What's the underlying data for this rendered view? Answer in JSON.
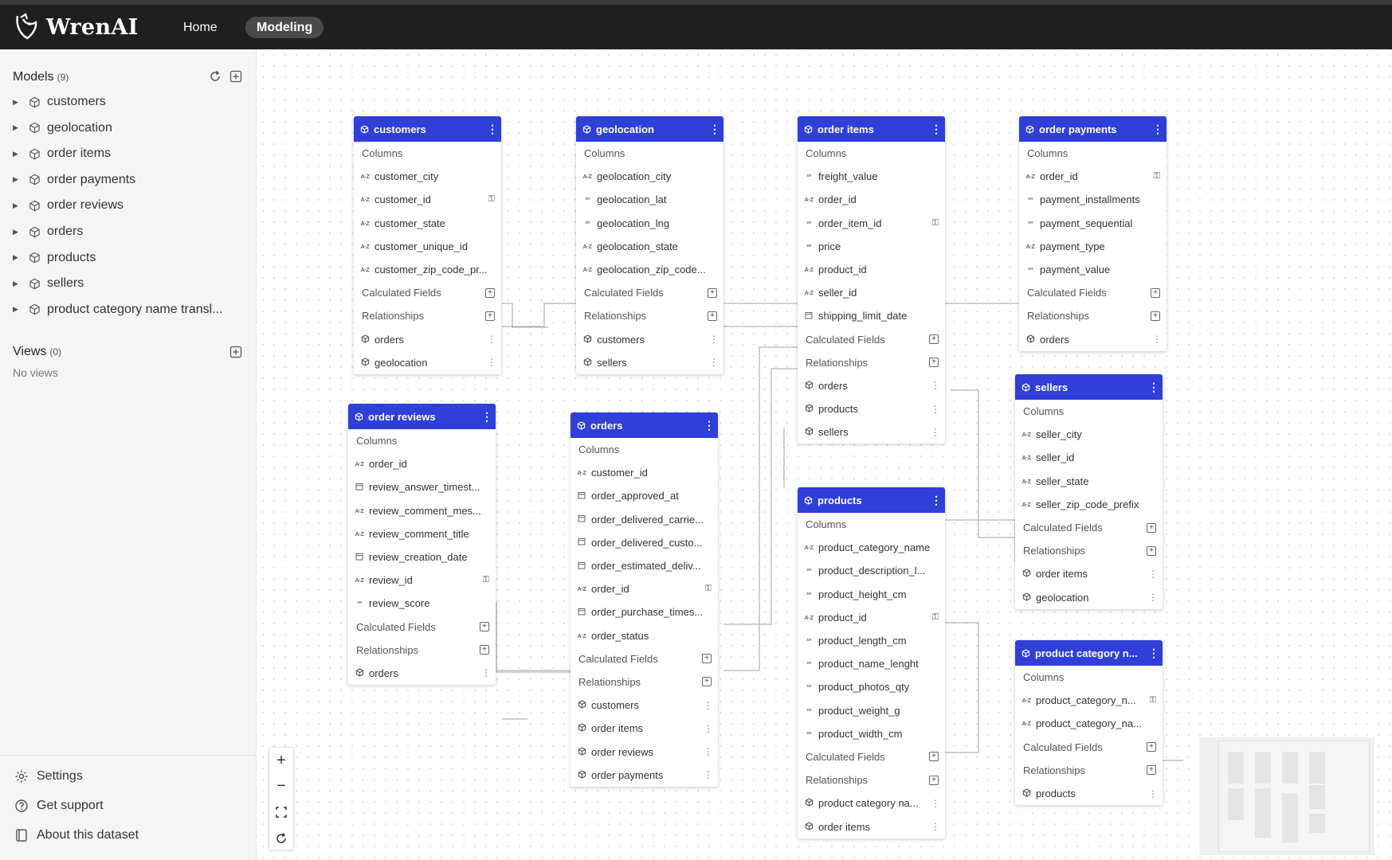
{
  "app": {
    "name": "WrenAI"
  },
  "nav": {
    "home": "Home",
    "modeling": "Modeling"
  },
  "sidebar": {
    "models_title": "Models",
    "models_count": "(9)",
    "models": [
      "customers",
      "geolocation",
      "order items",
      "order payments",
      "order reviews",
      "orders",
      "products",
      "sellers",
      "product category name transl..."
    ],
    "views_title": "Views",
    "views_count": "(0)",
    "views_empty": "No views",
    "footer": {
      "settings": "Settings",
      "support": "Get support",
      "about": "About this dataset"
    }
  },
  "nodes": [
    {
      "title": "customers",
      "columns": [
        [
          "az",
          "customer_city",
          0
        ],
        [
          "az",
          "customer_id",
          1
        ],
        [
          "az",
          "customer_state",
          0
        ],
        [
          "az",
          "customer_unique_id",
          0
        ],
        [
          "az",
          "customer_zip_code_pr...",
          0
        ]
      ],
      "relations": [
        "orders",
        "geolocation"
      ]
    },
    {
      "title": "geolocation",
      "columns": [
        [
          "az",
          "geolocation_city",
          0
        ],
        [
          "123",
          "geolocation_lat",
          0
        ],
        [
          "123",
          "geolocation_lng",
          0
        ],
        [
          "az",
          "geolocation_state",
          0
        ],
        [
          "az",
          "geolocation_zip_code...",
          0
        ]
      ],
      "relations": [
        "customers",
        "sellers"
      ]
    },
    {
      "title": "order items",
      "columns": [
        [
          "123",
          "freight_value",
          0
        ],
        [
          "az",
          "order_id",
          0
        ],
        [
          "123",
          "order_item_id",
          1
        ],
        [
          "123",
          "price",
          0
        ],
        [
          "az",
          "product_id",
          0
        ],
        [
          "az",
          "seller_id",
          0
        ],
        [
          "cal",
          "shipping_limit_date",
          0
        ]
      ],
      "relations": [
        "orders",
        "products",
        "sellers"
      ]
    },
    {
      "title": "order payments",
      "columns": [
        [
          "az",
          "order_id",
          1
        ],
        [
          "123",
          "payment_installments",
          0
        ],
        [
          "123",
          "payment_sequential",
          0
        ],
        [
          "az",
          "payment_type",
          0
        ],
        [
          "123",
          "payment_value",
          0
        ]
      ],
      "relations": [
        "orders"
      ]
    },
    {
      "title": "order reviews",
      "columns": [
        [
          "az",
          "order_id",
          0
        ],
        [
          "cal",
          "review_answer_timest...",
          0
        ],
        [
          "az",
          "review_comment_mes...",
          0
        ],
        [
          "az",
          "review_comment_title",
          0
        ],
        [
          "cal",
          "review_creation_date",
          0
        ],
        [
          "az",
          "review_id",
          1
        ],
        [
          "123",
          "review_score",
          0
        ]
      ],
      "relations": [
        "orders"
      ]
    },
    {
      "title": "orders",
      "columns": [
        [
          "az",
          "customer_id",
          0
        ],
        [
          "cal",
          "order_approved_at",
          0
        ],
        [
          "cal",
          "order_delivered_carrie...",
          0
        ],
        [
          "cal",
          "order_delivered_custo...",
          0
        ],
        [
          "cal",
          "order_estimated_deliv...",
          0
        ],
        [
          "az",
          "order_id",
          1
        ],
        [
          "cal",
          "order_purchase_times...",
          0
        ],
        [
          "az",
          "order_status",
          0
        ]
      ],
      "relations": [
        "customers",
        "order items",
        "order reviews",
        "order payments"
      ]
    },
    {
      "title": "products",
      "columns": [
        [
          "az",
          "product_category_name",
          0
        ],
        [
          "123",
          "product_description_l...",
          0
        ],
        [
          "123",
          "product_height_cm",
          0
        ],
        [
          "az",
          "product_id",
          1
        ],
        [
          "123",
          "product_length_cm",
          0
        ],
        [
          "123",
          "product_name_lenght",
          0
        ],
        [
          "123",
          "product_photos_qty",
          0
        ],
        [
          "123",
          "product_weight_g",
          0
        ],
        [
          "123",
          "product_width_cm",
          0
        ]
      ],
      "relations": [
        "product category na...",
        "order items"
      ]
    },
    {
      "title": "sellers",
      "columns": [
        [
          "az",
          "seller_city",
          0
        ],
        [
          "az",
          "seller_id",
          0
        ],
        [
          "az",
          "seller_state",
          0
        ],
        [
          "az",
          "seller_zip_code_prefix",
          0
        ]
      ],
      "relations": [
        "order items",
        "geolocation"
      ]
    },
    {
      "title": "product category n...",
      "columns": [
        [
          "az",
          "product_category_n...",
          1
        ],
        [
          "az",
          "product_category_na...",
          0
        ]
      ],
      "relations": [
        "products"
      ]
    }
  ],
  "labels": {
    "columns": "Columns",
    "calculated": "Calculated Fields",
    "relationships": "Relationships"
  },
  "colors": {
    "header": "#2f3fd8",
    "topbar": "#1f1f1f"
  }
}
